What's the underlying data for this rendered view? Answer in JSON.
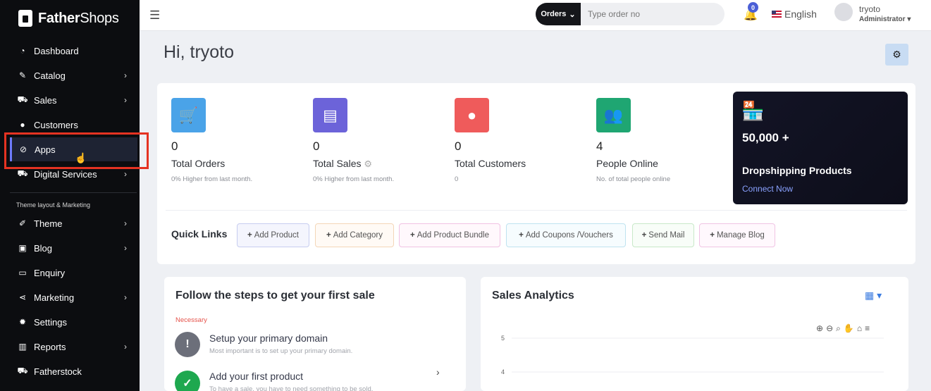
{
  "sidebar": {
    "brand_bold": "Father",
    "brand_light": "Shops",
    "items": [
      {
        "label": "Dashboard",
        "icon": "dashboard-icon",
        "glyph": "◔",
        "chevron": false
      },
      {
        "label": "Catalog",
        "icon": "tag-icon",
        "glyph": "✎",
        "chevron": true
      },
      {
        "label": "Sales",
        "icon": "cart-icon",
        "glyph": "⛟",
        "chevron": true
      },
      {
        "label": "Customers",
        "icon": "user-icon",
        "glyph": "●",
        "chevron": false
      },
      {
        "label": "Apps",
        "icon": "compass-icon",
        "glyph": "⊘",
        "chevron": false
      },
      {
        "label": "Digital Services",
        "icon": "cart-icon",
        "glyph": "⛟",
        "chevron": true
      }
    ],
    "section_title": "Theme layout & Marketing",
    "items2": [
      {
        "label": "Theme",
        "icon": "brush-icon",
        "glyph": "✐",
        "chevron": true
      },
      {
        "label": "Blog",
        "icon": "image-icon",
        "glyph": "▣",
        "chevron": true
      },
      {
        "label": "Enquiry",
        "icon": "inbox-icon",
        "glyph": "▭",
        "chevron": false
      },
      {
        "label": "Marketing",
        "icon": "share-icon",
        "glyph": "⋖",
        "chevron": true
      },
      {
        "label": "Settings",
        "icon": "gear-icon",
        "glyph": "✹",
        "chevron": false
      },
      {
        "label": "Reports",
        "icon": "bar-chart-icon",
        "glyph": "▥",
        "chevron": true
      },
      {
        "label": "Fatherstock",
        "icon": "cart-icon",
        "glyph": "⛟",
        "chevron": false
      }
    ],
    "chevron_glyph": "›"
  },
  "topbar": {
    "search_scope": "Orders",
    "search_placeholder": "Type order no",
    "notification_count": "0",
    "language": "English",
    "user_name": "tryoto",
    "user_role": "Administrator ▾"
  },
  "main": {
    "greeting": "Hi, tryoto",
    "stats": [
      {
        "value": "0",
        "label": "Total Orders",
        "sub": "0% Higher from last month.",
        "color": "#4aa3e8",
        "icon": "cart-icon",
        "glyph": "🛒"
      },
      {
        "value": "0",
        "label": "Total Sales",
        "sub": "0% Higher from last month.",
        "color": "#6c63d9",
        "icon": "card-icon",
        "glyph": "▤"
      },
      {
        "value": "0",
        "label": "Total Customers",
        "sub": "0",
        "color": "#ef5b5b",
        "icon": "user-icon",
        "glyph": "●"
      },
      {
        "value": "4",
        "label": "People Online",
        "sub": "No. of total people online",
        "color": "#1fa672",
        "icon": "users-icon",
        "glyph": "👥"
      }
    ],
    "promo": {
      "count": "50,000 +",
      "title": "Dropshipping Products",
      "link": "Connect Now"
    },
    "quick_links_label": "Quick Links",
    "quick_links": [
      {
        "label": "Add Product",
        "border": "#c7cdf0",
        "bg": "#f4f5fd"
      },
      {
        "label": "Add Category",
        "border": "#f4d6b8",
        "bg": "#fffaf5"
      },
      {
        "label": "Add Product Bundle",
        "border": "#f1c2e3",
        "bg": "#fff8fc"
      },
      {
        "label": "Add Coupons /Vouchers",
        "border": "#bfe3f0",
        "bg": "#f6fcfe"
      },
      {
        "label": "Send Mail",
        "border": "#c8e8c8",
        "bg": "#f8fdf8"
      },
      {
        "label": "Manage Blog",
        "border": "#f0c4e4",
        "bg": "#fff8fd"
      }
    ],
    "steps": {
      "title": "Follow the steps to get your first sale",
      "necessary": "Necessary",
      "items": [
        {
          "title": "Setup your primary domain",
          "desc": "Most important is to set up your primary domain.",
          "glyph": "!",
          "color": "#6c6f7a"
        },
        {
          "title": "Add your first product",
          "desc": "To have a sale, you have to need something to be sold.",
          "glyph": "✓",
          "color": "#1ea84f"
        }
      ]
    },
    "analytics": {
      "title": "Sales Analytics"
    }
  },
  "chart_data": {
    "type": "line",
    "title": "Sales Analytics",
    "y_ticks": [
      "5",
      "4"
    ],
    "series": []
  },
  "colors": {
    "accent": "#6e7bff",
    "highlight": "#e53322",
    "sidebar_bg": "#0c0d10"
  }
}
